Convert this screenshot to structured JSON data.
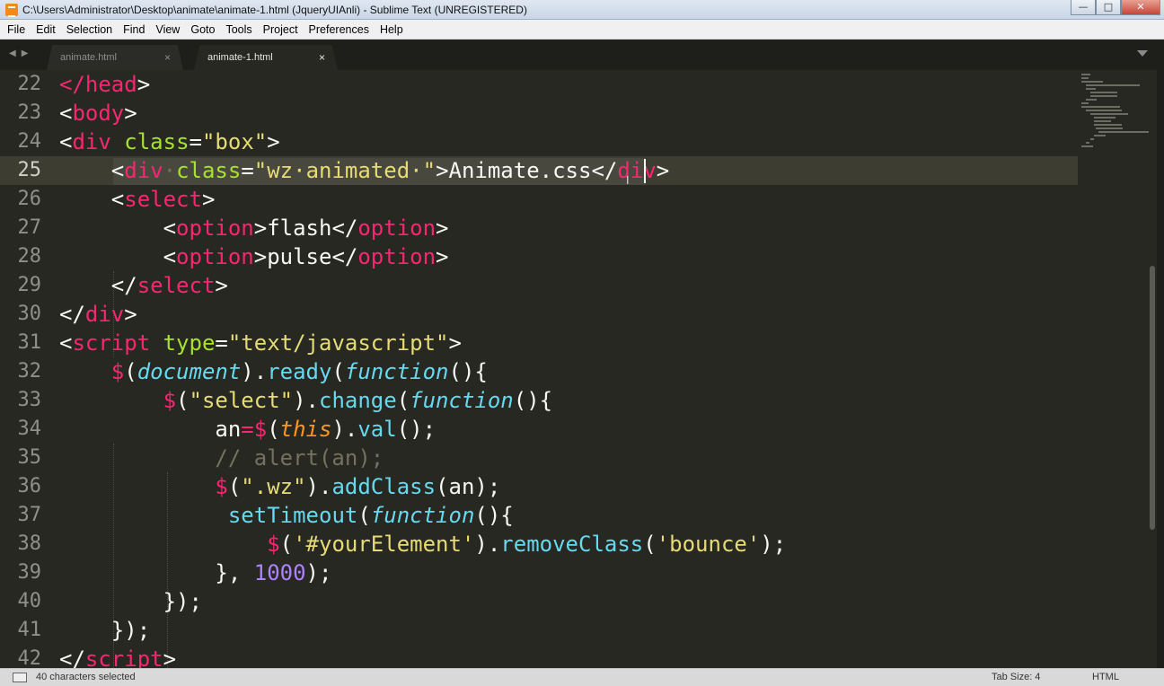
{
  "window": {
    "title": "C:\\Users\\Administrator\\Desktop\\animate\\animate-1.html (JqueryUIAnli) - Sublime Text (UNREGISTERED)",
    "controls": [
      "—",
      "□",
      "✕"
    ]
  },
  "menu": [
    "File",
    "Edit",
    "Selection",
    "Find",
    "View",
    "Goto",
    "Tools",
    "Project",
    "Preferences",
    "Help"
  ],
  "tabs": [
    {
      "label": "animate.html",
      "close": "×",
      "active": false
    },
    {
      "label": "animate-1.html",
      "close": "×",
      "active": true
    }
  ],
  "nav": {
    "back": "◀",
    "forward": "▶"
  },
  "editor": {
    "line_numbers": [
      "22",
      "23",
      "24",
      "25",
      "26",
      "27",
      "28",
      "29",
      "30",
      "31",
      "32",
      "33",
      "34",
      "35",
      "36",
      "37",
      "38",
      "39",
      "40",
      "41",
      "42"
    ],
    "current_line": "25",
    "code": [
      [
        [
          "t",
          "</"
        ],
        [
          "t",
          "head"
        ],
        [
          "p",
          ">"
        ]
      ],
      [
        [
          "p",
          "<"
        ],
        [
          "t",
          "body"
        ],
        [
          "p",
          ">"
        ]
      ],
      [
        [
          "p",
          "<"
        ],
        [
          "t",
          "div"
        ],
        [
          "p",
          " "
        ],
        [
          "a",
          "class"
        ],
        [
          "p",
          "="
        ],
        [
          "s",
          "\"box\""
        ],
        [
          "p",
          ">"
        ]
      ],
      [
        [
          "p",
          "    <"
        ],
        [
          "t",
          "div"
        ],
        [
          "ws",
          "·"
        ],
        [
          "a",
          "class"
        ],
        [
          "p",
          "="
        ],
        [
          "s",
          "\"wz·animated·\""
        ],
        [
          "p",
          ">Animate.css</"
        ],
        [
          "t",
          "div"
        ],
        [
          "p",
          ">"
        ]
      ],
      [
        [
          "p",
          "    <"
        ],
        [
          "t",
          "select"
        ],
        [
          "p",
          ">"
        ]
      ],
      [
        [
          "p",
          "        <"
        ],
        [
          "t",
          "option"
        ],
        [
          "p",
          ">flash</"
        ],
        [
          "t",
          "option"
        ],
        [
          "p",
          ">"
        ]
      ],
      [
        [
          "p",
          "        <"
        ],
        [
          "t",
          "option"
        ],
        [
          "p",
          ">pulse</"
        ],
        [
          "t",
          "option"
        ],
        [
          "p",
          ">"
        ]
      ],
      [
        [
          "p",
          "    </"
        ],
        [
          "t",
          "select"
        ],
        [
          "p",
          ">"
        ]
      ],
      [
        [
          "p",
          "</"
        ],
        [
          "t",
          "div"
        ],
        [
          "p",
          ">"
        ]
      ],
      [
        [
          "p",
          "<"
        ],
        [
          "t",
          "script"
        ],
        [
          "p",
          " "
        ],
        [
          "a",
          "type"
        ],
        [
          "p",
          "="
        ],
        [
          "s",
          "\"text/javascript\""
        ],
        [
          "p",
          ">"
        ]
      ],
      [
        [
          "p",
          "    "
        ],
        [
          "t",
          "$"
        ],
        [
          "p",
          "("
        ],
        [
          "i",
          "document"
        ],
        [
          "p",
          ")."
        ],
        [
          "f",
          "ready"
        ],
        [
          "p",
          "("
        ],
        [
          "i",
          "function"
        ],
        [
          "p",
          "(){"
        ]
      ],
      [
        [
          "p",
          "        "
        ],
        [
          "t",
          "$"
        ],
        [
          "p",
          "("
        ],
        [
          "s",
          "\"select\""
        ],
        [
          "p",
          ")."
        ],
        [
          "f",
          "change"
        ],
        [
          "p",
          "("
        ],
        [
          "i",
          "function"
        ],
        [
          "p",
          "(){"
        ]
      ],
      [
        [
          "p",
          "            an"
        ],
        [
          "t",
          "="
        ],
        [
          "t",
          "$"
        ],
        [
          "p",
          "("
        ],
        [
          "v",
          "this"
        ],
        [
          "p",
          ")."
        ],
        [
          "f",
          "val"
        ],
        [
          "p",
          "();"
        ]
      ],
      [
        [
          "c",
          "            // alert(an);"
        ]
      ],
      [
        [
          "p",
          "            "
        ],
        [
          "t",
          "$"
        ],
        [
          "p",
          "("
        ],
        [
          "s",
          "\".wz\""
        ],
        [
          "p",
          ")."
        ],
        [
          "f",
          "addClass"
        ],
        [
          "p",
          "(an);"
        ]
      ],
      [
        [
          "p",
          "             "
        ],
        [
          "f",
          "setTimeout"
        ],
        [
          "p",
          "("
        ],
        [
          "i",
          "function"
        ],
        [
          "p",
          "(){"
        ]
      ],
      [
        [
          "p",
          "                "
        ],
        [
          "t",
          "$"
        ],
        [
          "p",
          "("
        ],
        [
          "s",
          "'#yourElement'"
        ],
        [
          "p",
          ")."
        ],
        [
          "f",
          "removeClass"
        ],
        [
          "p",
          "("
        ],
        [
          "s",
          "'bounce'"
        ],
        [
          "p",
          ");"
        ]
      ],
      [
        [
          "p",
          "            }, "
        ],
        [
          "n",
          "1000"
        ],
        [
          "p",
          ");"
        ]
      ],
      [
        [
          "p",
          "        });"
        ]
      ],
      [
        [
          "p",
          "    });"
        ]
      ],
      [
        [
          "p",
          "</"
        ],
        [
          "t",
          "script"
        ],
        [
          "p",
          ">"
        ]
      ]
    ]
  },
  "status": {
    "selection": "40 characters selected",
    "tab_size": "Tab Size: 4",
    "syntax": "HTML"
  },
  "colors": {
    "background": "#272822",
    "tag": "#f92672",
    "attribute": "#a6e22e",
    "string": "#e6db74",
    "function": "#66d9ef",
    "comment": "#75715e",
    "number": "#ae81ff"
  }
}
